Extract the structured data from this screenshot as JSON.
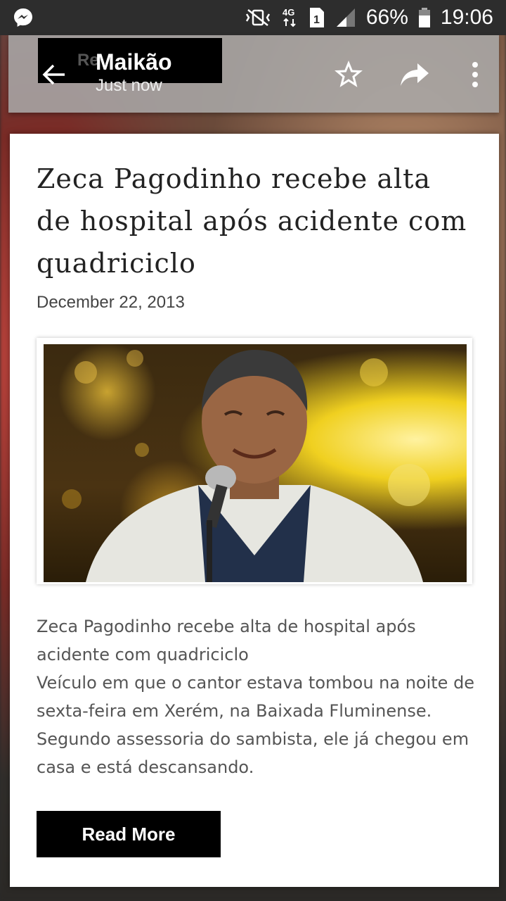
{
  "status_bar": {
    "battery_percent": "66%",
    "time": "19:06",
    "network": "4G",
    "sim_slot": "1",
    "icons": [
      "messenger-icon",
      "vibrate-mute-icon",
      "network-4g-icon",
      "sim-1-icon",
      "signal-icon",
      "battery-icon"
    ]
  },
  "header": {
    "title": "Maikão",
    "subtitle": "Just now",
    "ghost_label": "Re",
    "actions": [
      "back-arrow-icon",
      "star-icon",
      "share-icon",
      "more-vert-icon"
    ]
  },
  "article": {
    "title": "Zeca Pagodinho recebe alta de hospital após acidente com quadriciclo",
    "date": "December 22, 2013",
    "excerpt_line1": "Zeca Pagodinho recebe alta de hospital após acidente com quadriciclo",
    "excerpt_line2": "Veículo em que o cantor estava tombou na noite de sexta-feira em Xerém, na Baixada Fluminense. Segundo assessoria do sambista, ele já chegou em casa e está descansando.",
    "read_more_label": "Read More",
    "photo_description": "singer-photo"
  },
  "colors": {
    "status_bar": "#2d2d2d",
    "header_overlay": "#aaaaaa",
    "button": "#000000"
  }
}
